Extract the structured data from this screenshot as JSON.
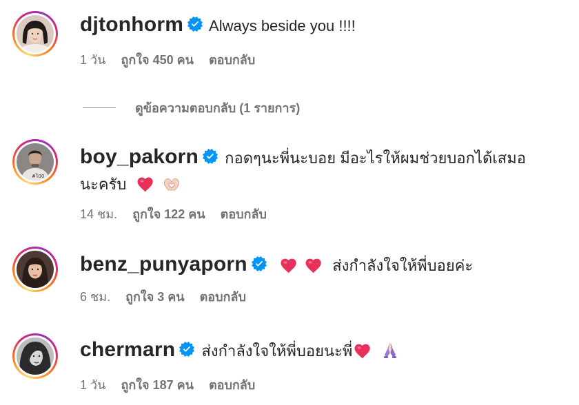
{
  "comments": [
    {
      "username": "djtonhorm",
      "text": "Always beside you !!!!",
      "time": "1 วัน",
      "likes": "ถูกใจ 450 คน",
      "reply": "ตอบกลับ",
      "avatar_icon": "avatar-woman-portrait",
      "emojis": []
    },
    {
      "username": "boy_pakorn",
      "text": "กอดๆนะพี่นะบอย มีอะไรให้ผมช่วยบอกได้เสมอ",
      "text2": "นะครับ",
      "time": "14 ชม.",
      "likes": "ถูกใจ 122 คน",
      "reply": "ตอบกลับ",
      "avatar_icon": "avatar-man-portrait",
      "emojis": [
        "heart-icon",
        "heart-hands-icon"
      ]
    },
    {
      "username": "benz_punyaporn",
      "text": "ส่งกำลังใจให้พี่บอยค่ะ",
      "time": "6 ชม.",
      "likes": "ถูกใจ 3 คน",
      "reply": "ตอบกลับ",
      "avatar_icon": "avatar-woman-portrait",
      "emojis": [
        "heart-icon",
        "heart-icon"
      ]
    },
    {
      "username": "chermarn",
      "text": "ส่งกำลังใจให้พี่บอยนะพี่",
      "time": "1 วัน",
      "likes": "ถูกใจ 187 คน",
      "reply": "ตอบกลับ",
      "avatar_icon": "avatar-woman-bw-portrait",
      "emojis": [
        "heart-icon",
        "folded-hands-icon"
      ]
    }
  ],
  "view_replies": "ดูข้อความตอบกลับ (1 รายการ)",
  "colors": {
    "verified": "#0095f6",
    "heart": "#e0245e",
    "meta": "#737373",
    "text": "#262626"
  }
}
